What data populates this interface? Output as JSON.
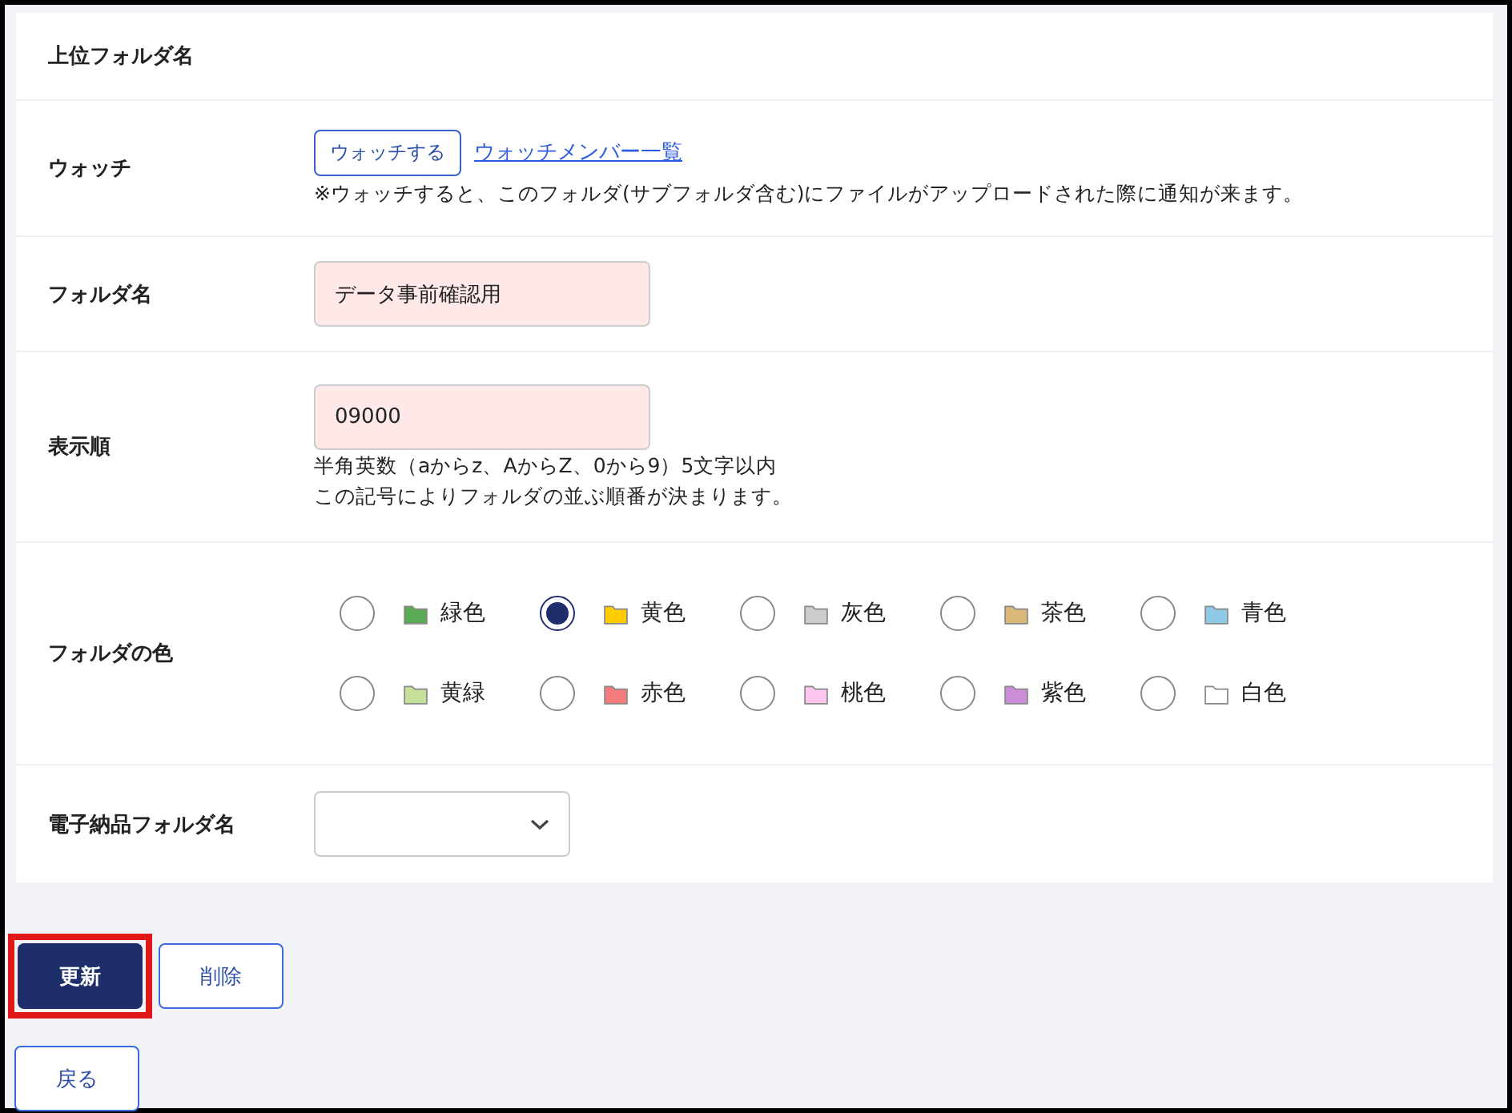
{
  "form": {
    "rows": [
      {
        "kind": "empty",
        "label": "上位フォルダ名"
      },
      {
        "kind": "watch",
        "label": "ウォッチ",
        "button": "ウォッチする",
        "link": "ウォッチメンバー一覧",
        "note": "※ウォッチすると、このフォルダ(サブフォルダ含む)にファイルがアップロードされた際に通知が来ます。"
      },
      {
        "kind": "text",
        "label": "フォルダ名",
        "value": "データ事前確認用",
        "invalid": true
      },
      {
        "kind": "text",
        "label": "表示順",
        "value": "09000",
        "invalid": true,
        "hints": [
          "半角英数（aからz、AからZ、0から9）5文字以内",
          "この記号によりフォルダの並ぶ順番が決まります。"
        ]
      },
      {
        "kind": "colors",
        "label": "フォルダの色",
        "options": [
          {
            "label": "緑色",
            "color": "#5aaa55",
            "selected": false
          },
          {
            "label": "黄色",
            "color": "#ffcc00",
            "selected": true
          },
          {
            "label": "灰色",
            "color": "#cccccc",
            "selected": false
          },
          {
            "label": "茶色",
            "color": "#d9b87a",
            "selected": false
          },
          {
            "label": "青色",
            "color": "#8ec9e6",
            "selected": false
          },
          {
            "label": "黄緑",
            "color": "#c5e09a",
            "selected": false
          },
          {
            "label": "赤色",
            "color": "#f47c7c",
            "selected": false
          },
          {
            "label": "桃色",
            "color": "#ffc6f0",
            "selected": false
          },
          {
            "label": "紫色",
            "color": "#cc8ed9",
            "selected": false
          },
          {
            "label": "白色",
            "color": "#ffffff",
            "selected": false
          }
        ]
      },
      {
        "kind": "select",
        "label": "電子納品フォルダ名"
      }
    ]
  },
  "actions": [
    {
      "label": "更新",
      "kind": "primary",
      "highlighted": true
    },
    {
      "label": "削除",
      "kind": "secondary",
      "highlighted": false
    },
    {
      "label": "戻る",
      "kind": "secondary",
      "highlighted": false
    }
  ]
}
